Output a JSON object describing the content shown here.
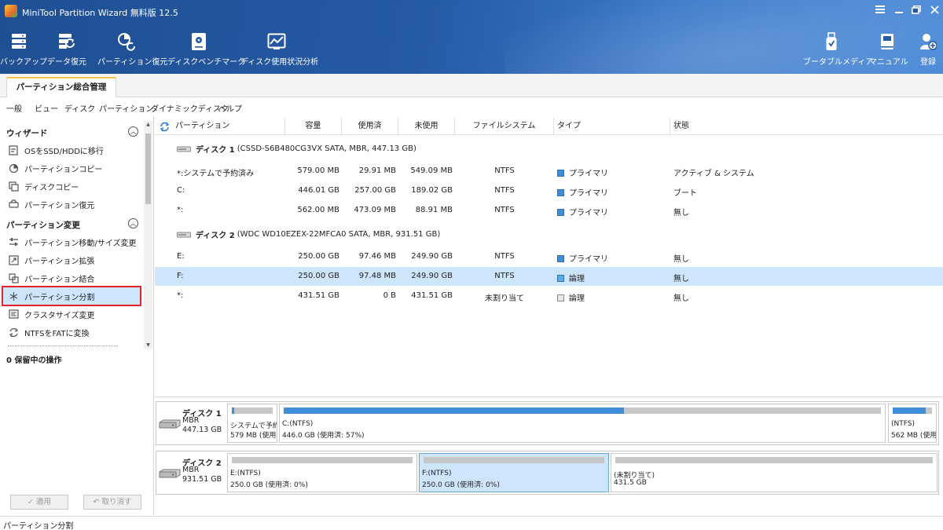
{
  "window": {
    "title": "MiniTool Partition Wizard 無料版 12.5"
  },
  "toolbar": {
    "backup": "バックアップ",
    "data_recovery": "データ復元",
    "partition_recovery": "パーティション復元",
    "disk_benchmark": "ディスクベンチマーク",
    "space_analyzer": "ディスク使用状況分析",
    "bootable_media": "ブータブルメディア",
    "manual": "マニュアル",
    "register": "登録"
  },
  "tabs": {
    "main_tab": "パーティション総合管理"
  },
  "menu": [
    "一般",
    "ビュー",
    "ディスク",
    "パーティション",
    "ダイナミックディスク",
    "ヘルプ"
  ],
  "sidebar": {
    "wizard_title": "ウィザード",
    "wizard_items": [
      {
        "label": "OSをSSD/HDDに移行",
        "icon": "migrate-os-icon"
      },
      {
        "label": "パーティションコピー",
        "icon": "copy-partition-icon"
      },
      {
        "label": "ディスクコピー",
        "icon": "copy-disk-icon"
      },
      {
        "label": "パーティション復元",
        "icon": "partition-recovery-icon"
      }
    ],
    "change_title": "パーティション変更",
    "change_items": [
      {
        "label": "パーティション移動/サイズ変更",
        "icon": "move-resize-icon"
      },
      {
        "label": "パーティション拡張",
        "icon": "extend-icon"
      },
      {
        "label": "パーティション結合",
        "icon": "merge-icon"
      },
      {
        "label": "パーティション分割",
        "icon": "split-icon"
      },
      {
        "label": "クラスタサイズ変更",
        "icon": "cluster-size-icon"
      },
      {
        "label": "NTFSをFATに変換",
        "icon": "convert-icon"
      }
    ],
    "pending": "0 保留中の操作",
    "apply": "✓ 適用",
    "undo": "↶ 取り消す"
  },
  "table": {
    "headers": [
      "パーティション",
      "容量",
      "使用済",
      "未使用",
      "ファイルシステム",
      "タイプ",
      "状態"
    ],
    "disks": [
      {
        "name": "ディスク 1",
        "detail": "(CSSD-S6B480CG3VX SATA, MBR, 447.13 GB)",
        "partitions": [
          {
            "name": "*:システムで予約済み",
            "capacity": "579.00 MB",
            "used": "29.91 MB",
            "unused": "549.09 MB",
            "fs": "NTFS",
            "type": "プライマリ",
            "type_kind": "primary",
            "status": "アクティブ & システム",
            "selected": false
          },
          {
            "name": "C:",
            "capacity": "446.01 GB",
            "used": "257.00 GB",
            "unused": "189.02 GB",
            "fs": "NTFS",
            "type": "プライマリ",
            "type_kind": "primary",
            "status": "ブート",
            "selected": false
          },
          {
            "name": "*:",
            "capacity": "562.00 MB",
            "used": "473.09 MB",
            "unused": "88.91 MB",
            "fs": "NTFS",
            "type": "プライマリ",
            "type_kind": "primary",
            "status": "無し",
            "selected": false
          }
        ]
      },
      {
        "name": "ディスク 2",
        "detail": "(WDC WD10EZEX-22MFCA0 SATA, MBR, 931.51 GB)",
        "partitions": [
          {
            "name": "E:",
            "capacity": "250.00 GB",
            "used": "97.46 MB",
            "unused": "249.90 GB",
            "fs": "NTFS",
            "type": "プライマリ",
            "type_kind": "primary",
            "status": "無し",
            "selected": false
          },
          {
            "name": "F:",
            "capacity": "250.00 GB",
            "used": "97.48 MB",
            "unused": "249.90 GB",
            "fs": "NTFS",
            "type": "論理",
            "type_kind": "logical",
            "status": "無し",
            "selected": true
          },
          {
            "name": "*:",
            "capacity": "431.51 GB",
            "used": "0 B",
            "unused": "431.51 GB",
            "fs": "未割り当て",
            "type": "論理",
            "type_kind": "unallocated",
            "status": "無し",
            "selected": false
          }
        ]
      }
    ]
  },
  "diskmap": [
    {
      "name": "ディスク 1",
      "style": "MBR",
      "size": "447.13 GB",
      "parts": [
        {
          "l1": "システムで予約",
          "l2": "579 MB (使用",
          "used_fraction": 0.05,
          "selected": false
        },
        {
          "l1": "C:(NTFS)",
          "l2": "446.0 GB (使用済: 57%)",
          "used_fraction": 0.57,
          "selected": false
        },
        {
          "l1": "(NTFS)",
          "l2": "562 MB (使用",
          "used_fraction": 0.84,
          "selected": false
        }
      ]
    },
    {
      "name": "ディスク 2",
      "style": "MBR",
      "size": "931.51 GB",
      "parts": [
        {
          "l1": "E:(NTFS)",
          "l2": "250.0 GB (使用済: 0%)",
          "used_fraction": 0.0,
          "selected": false
        },
        {
          "l1": "F:(NTFS)",
          "l2": "250.0 GB (使用済: 0%)",
          "used_fraction": 0.0,
          "selected": true
        },
        {
          "l1": "(未割り当て)",
          "l2": "431.5 GB",
          "used_fraction": 0.0,
          "selected": false
        }
      ]
    }
  ],
  "statusbar": {
    "text": "パーティション分割"
  },
  "colors": {
    "toolbar_bg": "#255aa5",
    "selection": "#cde6fb",
    "highlight_border": "#e3242b",
    "used_bar": "#3d8ed6",
    "tab_accent": "#f3c64a"
  }
}
